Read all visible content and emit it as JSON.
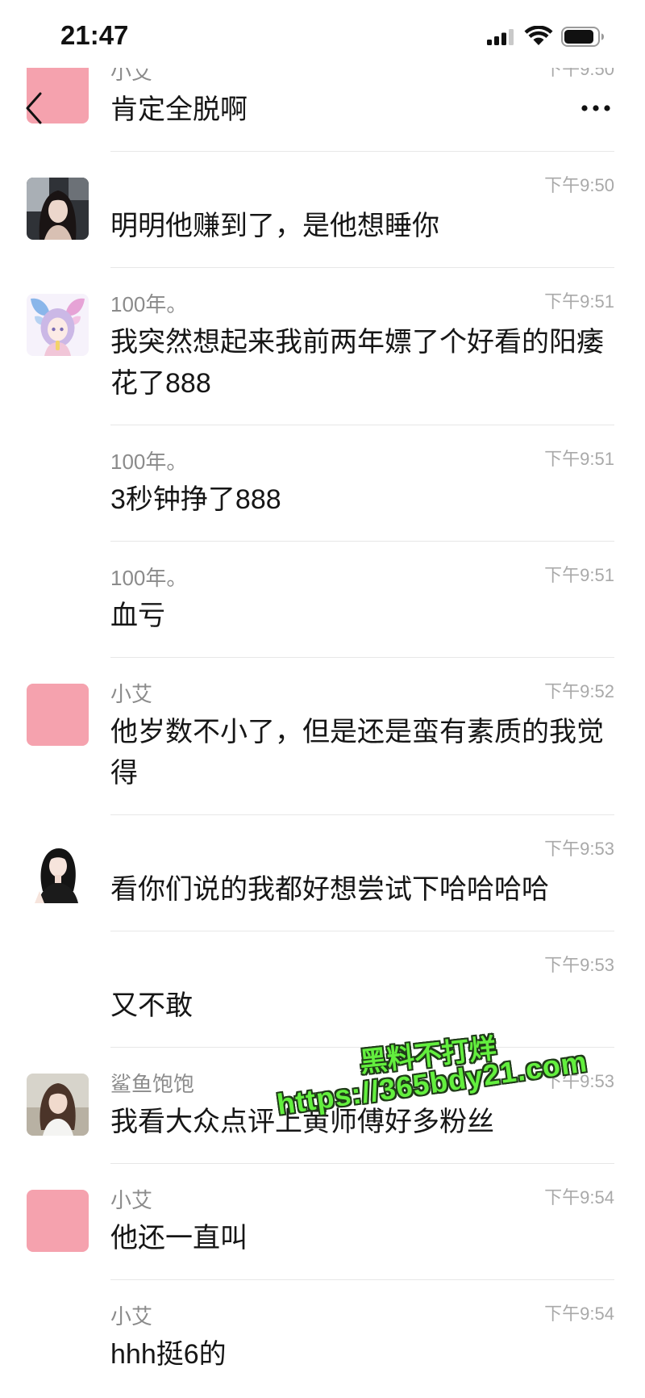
{
  "status_bar": {
    "time": "21:47",
    "signal_level": 3,
    "signal_max": 4,
    "battery_level": 0.9
  },
  "header": {
    "back_icon": "chevron-left-icon",
    "more_icon": "more-dots-icon"
  },
  "messages": [
    {
      "name": "小艾",
      "time": "下午9:50",
      "lines": [
        "肯定全脱啊"
      ],
      "avatar": "pink-square-avatar"
    },
    {
      "time": "下午9:50",
      "lines": [
        "明明他赚到了，是他想睡你"
      ],
      "avatar": "woman-photo-avatar"
    },
    {
      "name": "100年。",
      "time": "下午9:51",
      "lines": [
        "我突然想起来我前两年嫖了个好看的阳痿",
        "花了888"
      ],
      "avatar": "butterfly-anime-avatar"
    },
    {
      "name": "100年。",
      "time": "下午9:51",
      "lines": [
        "3秒钟挣了888"
      ]
    },
    {
      "name": "100年。",
      "time": "下午9:51",
      "lines": [
        "血亏"
      ]
    },
    {
      "name": "小艾",
      "time": "下午9:52",
      "lines": [
        "他岁数不小了，但是还是蛮有素质的我觉",
        "得"
      ],
      "avatar": "pink-square-avatar"
    },
    {
      "time": "下午9:53",
      "lines": [
        "看你们说的我都好想尝试下哈哈哈哈"
      ],
      "avatar": "black-hair-illustration-avatar"
    },
    {
      "time": "下午9:53",
      "lines": [
        "又不敢"
      ]
    },
    {
      "name": "鲨鱼饱饱",
      "time": "下午9:53",
      "lines": [
        "我看大众点评上黄师傅好多粉丝"
      ],
      "avatar": "woman-outdoor-photo-avatar"
    },
    {
      "name": "小艾",
      "time": "下午9:54",
      "lines": [
        "他还一直叫"
      ],
      "avatar": "pink-square-avatar"
    },
    {
      "name": "小艾",
      "time": "下午9:54",
      "lines": [
        "hhh挺6的"
      ]
    }
  ],
  "watermark": {
    "title": "黑料不打烊",
    "url": "https://365bdy21.com"
  },
  "colors": {
    "avatar_pink": "#f5a2ae",
    "text": "#161616",
    "sender_name": "#8b8b8b",
    "time": "#a9a9a9",
    "divider": "#e7e7e7",
    "watermark_green": "#63ef3e",
    "watermark_outline": "#1f3a18"
  }
}
